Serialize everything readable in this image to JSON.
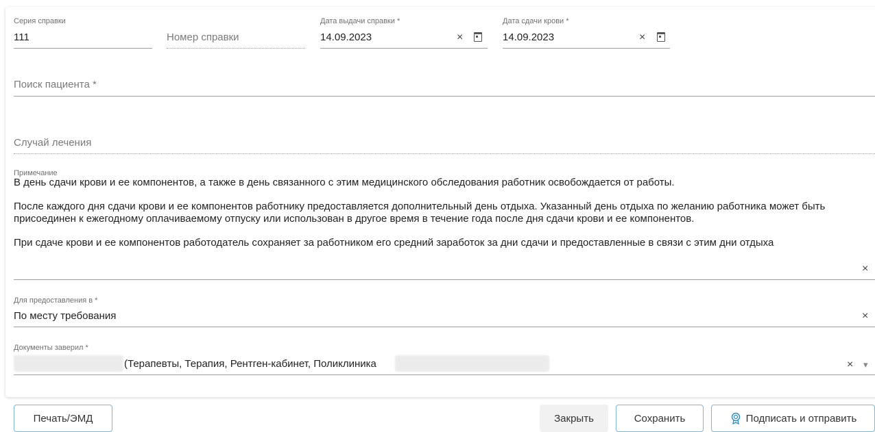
{
  "form": {
    "series": {
      "label": "Серия справки",
      "value": "111"
    },
    "number": {
      "placeholder": "Номер справки"
    },
    "issue_date": {
      "label": "Дата выдачи справки *",
      "value": "14.09.2023"
    },
    "donation_date": {
      "label": "Дата сдачи крови *",
      "value": "14.09.2023"
    },
    "patient_search": {
      "placeholder": "Поиск пациента *"
    },
    "treatment_case": {
      "placeholder": "Случай лечения"
    },
    "note": {
      "label": "Примечание",
      "paragraphs": [
        "В день сдачи крови и ее компонентов, а также в день связанного с этим медицинского обследования работник освобождается от работы.",
        "После каждого дня сдачи крови и ее компонентов работнику предоставляется дополнительный день отдыха. Указанный день отдыха по желанию работника может быть присоединен к ежегодному оплачиваемому отпуску или использован в другое время в течение года после дня сдачи крови и ее компонентов.",
        "При сдаче крови и ее компонентов работодатель сохраняет за работником его средний заработок за дни сдачи и предоставленные в связи с этим дни отдыха"
      ]
    },
    "provide_to": {
      "label": "Для предоставления в *",
      "value": "По месту требования"
    },
    "certified_by": {
      "label": "Документы заверил *",
      "value": "(Терапевты, Терапия, Рентген-кабинет, Поликлиника"
    }
  },
  "icons": {
    "clear": "×",
    "dropdown": "▾"
  },
  "buttons": {
    "print": "Печать/ЭМД",
    "close": "Закрыть",
    "save": "Сохранить",
    "sign_send": "Подписать и отправить"
  }
}
